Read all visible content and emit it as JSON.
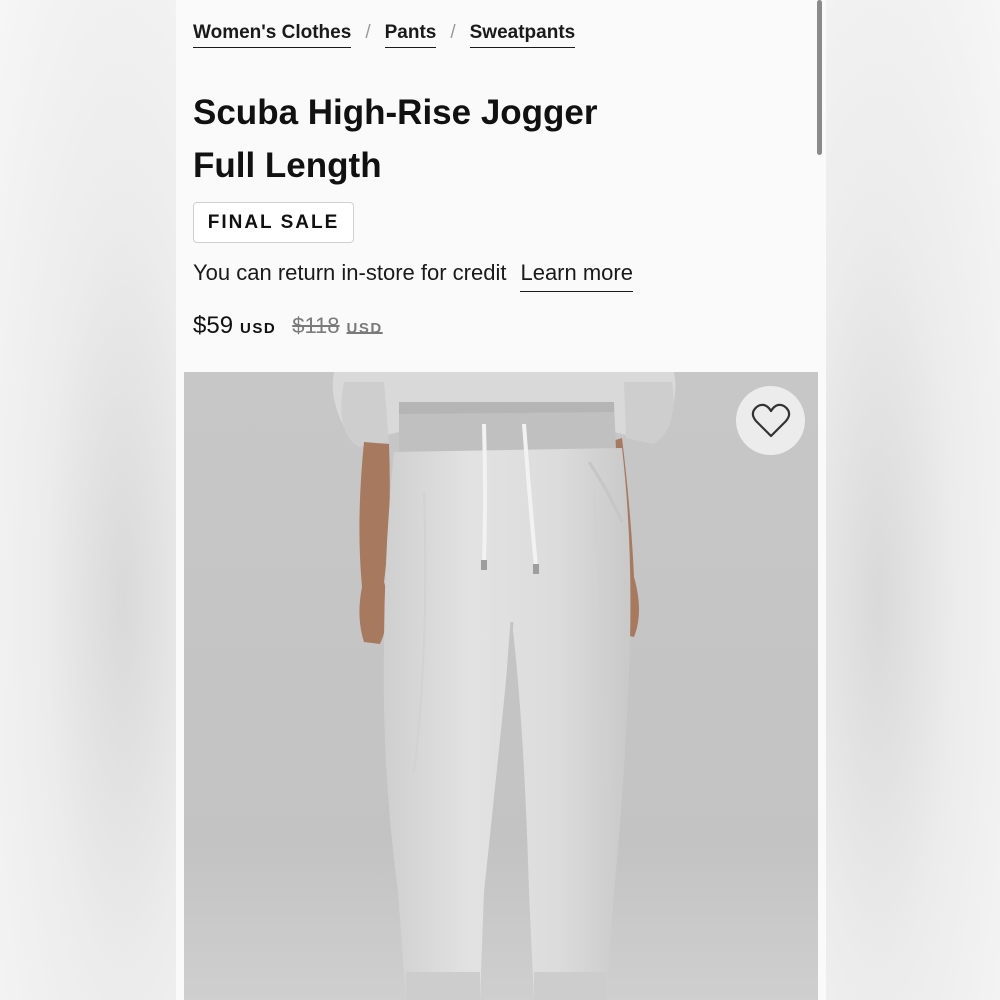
{
  "breadcrumb": {
    "items": [
      "Women's Clothes",
      "Pants",
      "Sweatpants"
    ],
    "separator": "/"
  },
  "product": {
    "title_line1": "Scuba High-Rise Jogger",
    "title_line2": "Full Length",
    "badge": "FINAL SALE",
    "return_text": "You can return in-store for credit",
    "learn_more": "Learn more",
    "price_current": "$59",
    "price_current_currency": "USD",
    "price_original": "$118",
    "price_original_currency": "USD",
    "image_icon": "heart-icon",
    "image_subject": "light heather grey jogger pants"
  },
  "colors": {
    "text": "#111111",
    "strikethrough": "#7a7a7a",
    "image_background": "#c6c6c6",
    "pants": "#dcdcdc"
  }
}
